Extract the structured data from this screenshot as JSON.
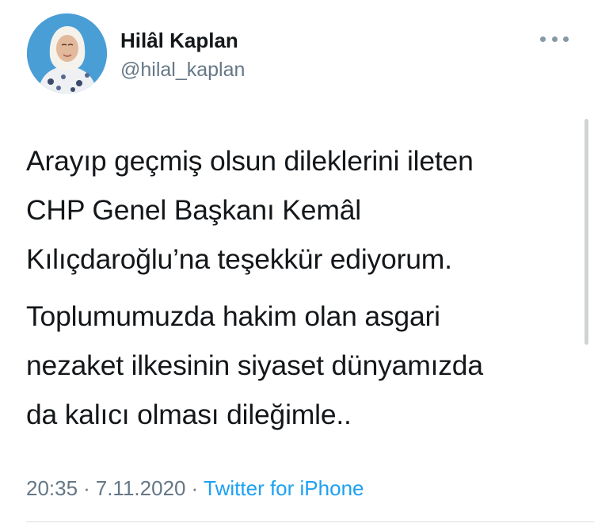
{
  "author": {
    "display_name": "Hilâl Kaplan",
    "handle": "@hilal_kaplan"
  },
  "tweet": {
    "paragraphs": [
      "Arayıp geçmiş olsun dileklerini ileten\nCHP Genel Başkanı Kemâl\nKılıçdaroğlu’na teşekkür ediyorum.",
      "Toplumumuzda hakim olan asgari\nnezaket ilkesinin siyaset dünyamızda\nda kalıcı olması dileğimle.."
    ]
  },
  "meta": {
    "time": "20:35",
    "date": "7.11.2020",
    "separator": "·",
    "source": "Twitter for iPhone"
  },
  "icons": {
    "more": "more-options-icon",
    "avatar": "profile-photo"
  },
  "colors": {
    "text": "#14171a",
    "secondary": "#657786",
    "link": "#1da1f2",
    "avatar_bg": "#4a9ed6"
  }
}
